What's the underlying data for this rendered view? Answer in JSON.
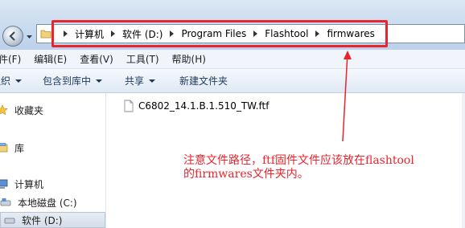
{
  "address_bar": {
    "crumbs": [
      "计算机",
      "软件 (D:)",
      "Program Files",
      "Flashtool",
      "firmwares"
    ]
  },
  "menubar": {
    "items": [
      "件(F)",
      "编辑(E)",
      "查看(V)",
      "工具(T)",
      "帮助(H)"
    ]
  },
  "command_bar": {
    "organize": "组织",
    "include_in_library": "包含到库中",
    "share": "共享",
    "new_folder": "新建文件夹"
  },
  "nav_pane": {
    "favorites": "收藏夹",
    "libraries": "库",
    "computer": "计算机",
    "local_disk_c": "本地磁盘 (C:)",
    "software_d": "软件 (D:)"
  },
  "files": [
    {
      "name": "C6802_14.1.B.1.510_TW.ftf"
    }
  ],
  "annotation": {
    "line1": "注意文件路径，ftf固件文件应该放在flashtool",
    "line2": "的firmwares文件夹内。",
    "color": "#e8242c"
  }
}
